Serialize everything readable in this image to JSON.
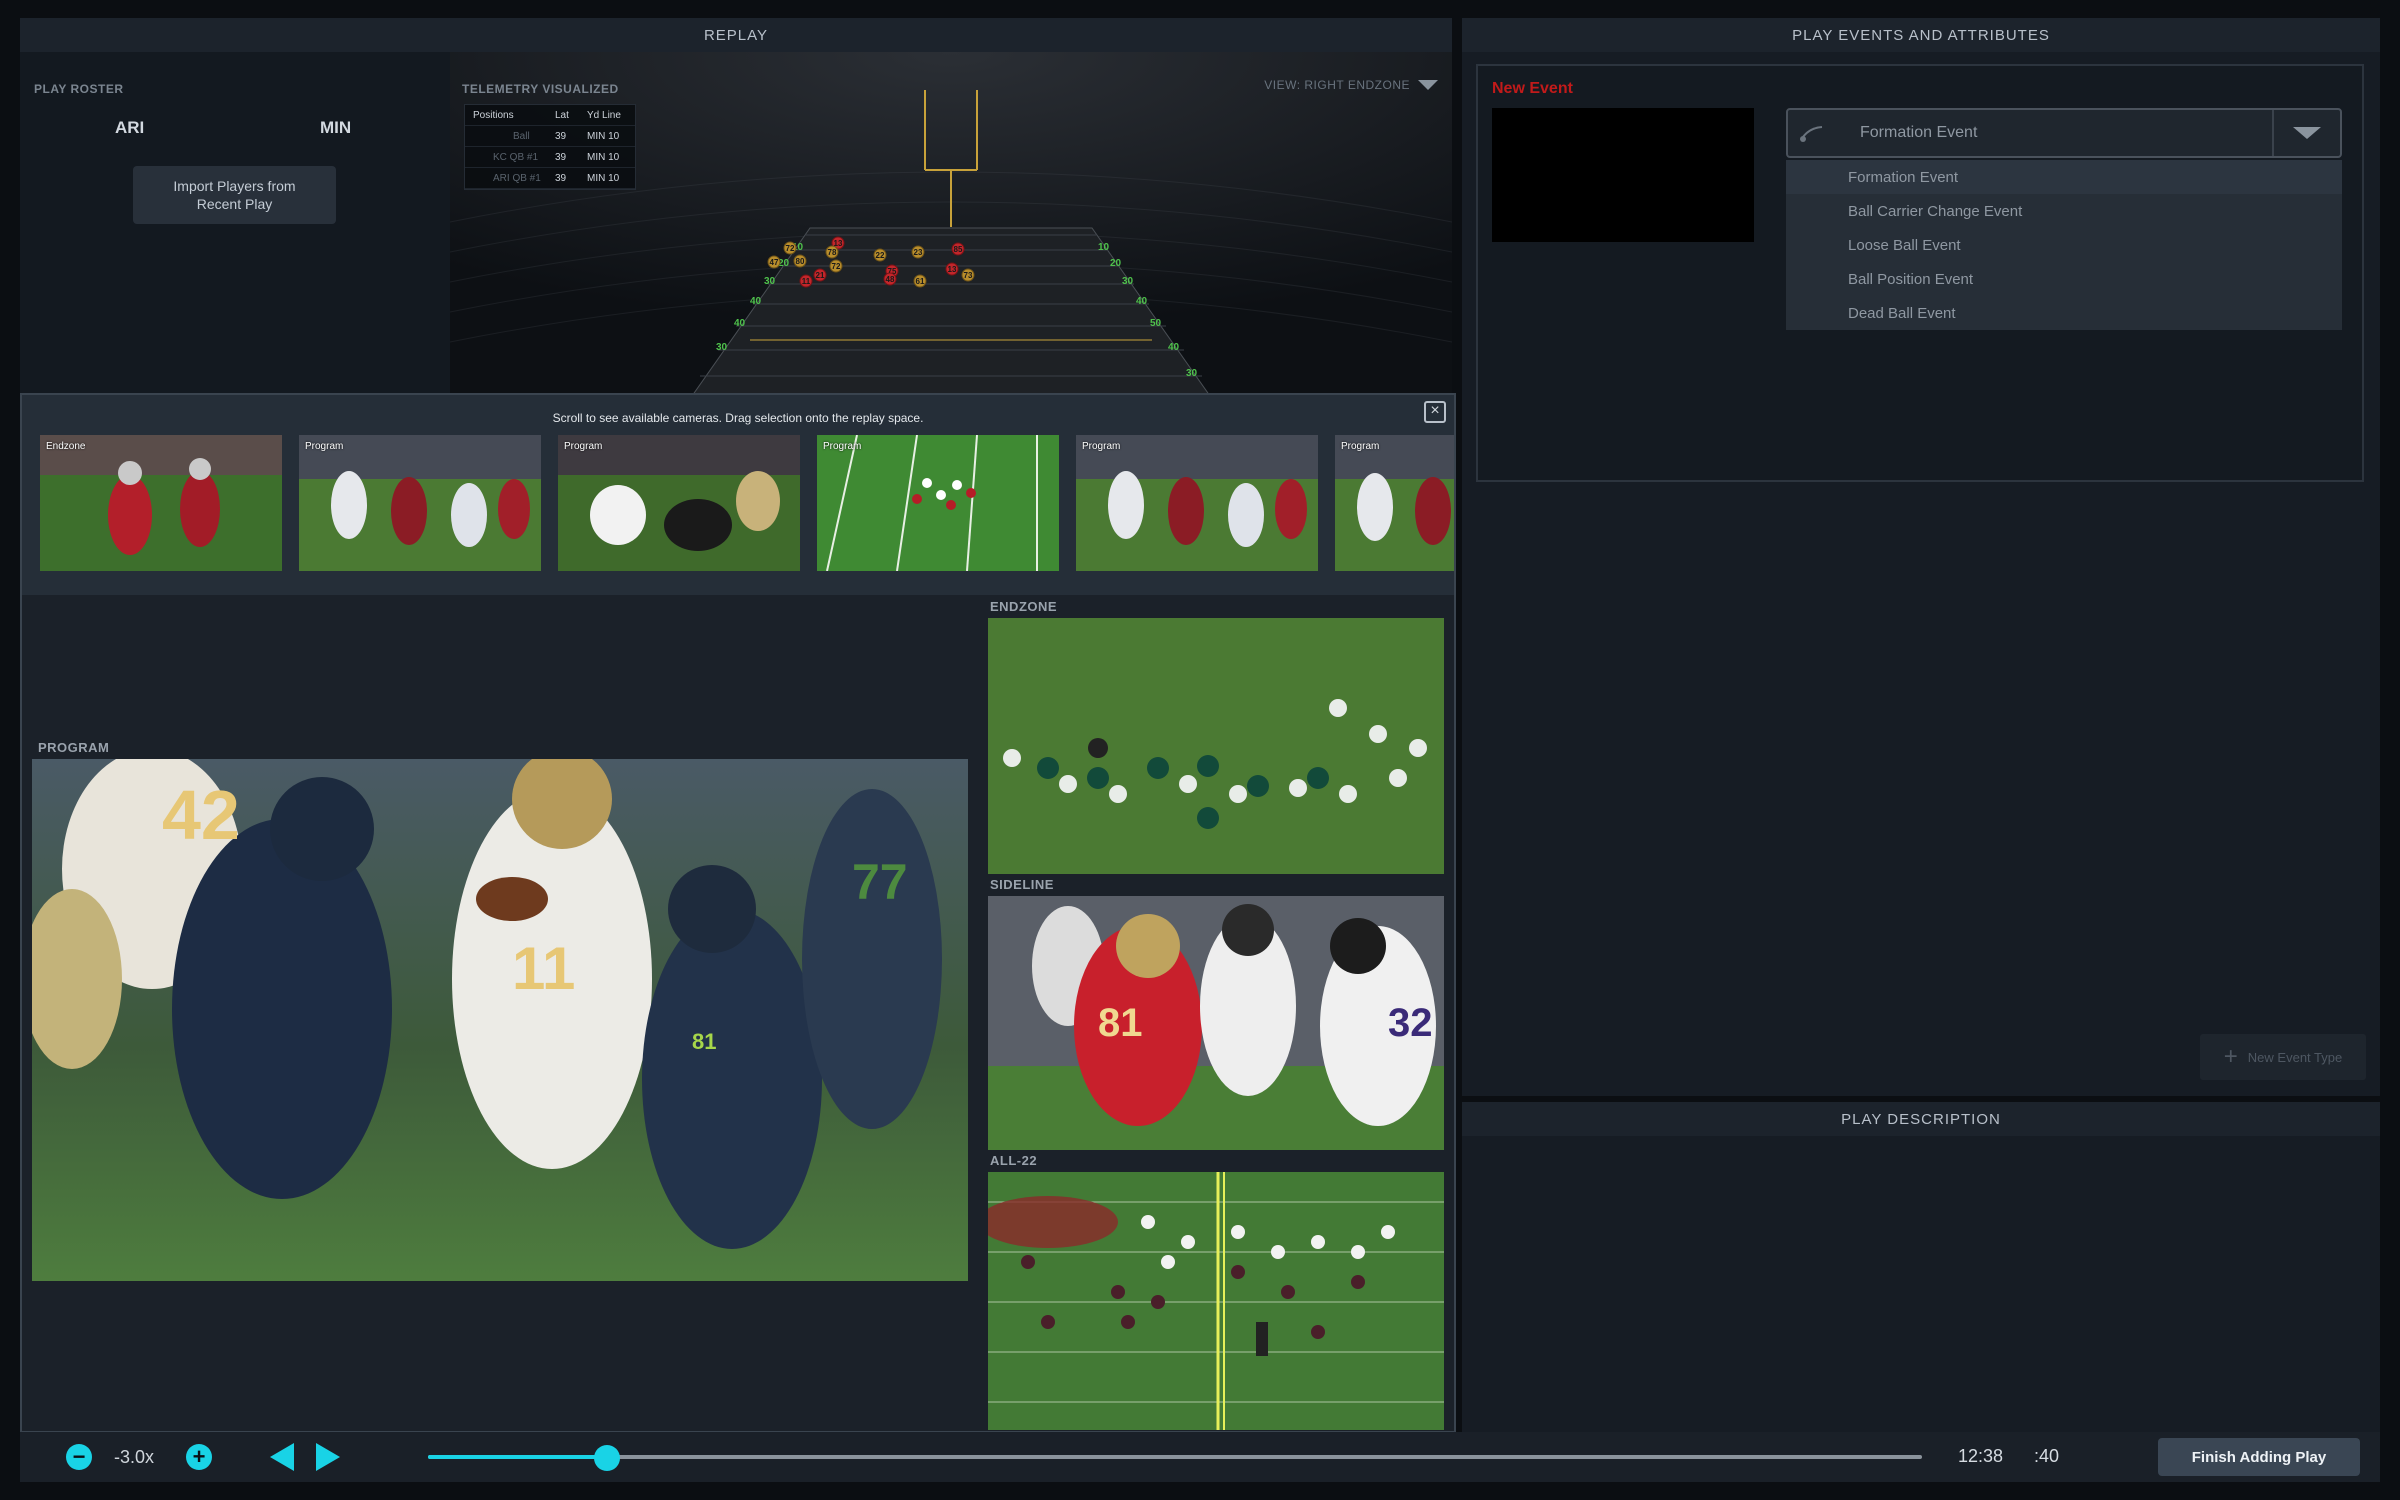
{
  "replay": {
    "title": "REPLAY",
    "roster_label": "PLAY ROSTER",
    "team_left": "ARI",
    "team_right": "MIN",
    "import_button": "Import Players from\nRecent Play",
    "telemetry_label": "TELEMETRY VISUALIZED",
    "view_label": "VIEW: RIGHT ENDZONE",
    "positions": {
      "headers": [
        "Positions",
        "Lat",
        "Yd Line"
      ],
      "rows": [
        {
          "name": "Ball",
          "lat": "39",
          "yd": "MIN 10"
        },
        {
          "name": "KC QB #1",
          "lat": "39",
          "yd": "MIN 10"
        },
        {
          "name": "ARI QB #1",
          "lat": "39",
          "yd": "MIN 10"
        }
      ]
    },
    "yard_markers_left": [
      "10",
      "20",
      "30",
      "40",
      "40",
      "30"
    ],
    "yard_markers_right": [
      "10",
      "20",
      "30",
      "40",
      "50",
      "40",
      "30"
    ],
    "player_numbers_red": [
      "13",
      "85",
      "13",
      "75",
      "21",
      "48",
      "11"
    ],
    "player_numbers_gold": [
      "72",
      "78",
      "22",
      "23",
      "47",
      "80",
      "72",
      "73",
      "61"
    ]
  },
  "events": {
    "title": "PLAY EVENTS AND ATTRIBUTES",
    "new_event_label": "New Event",
    "selected": "Formation Event",
    "options": [
      "Formation Event",
      "Ball Carrier Change Event",
      "Loose Ball Event",
      "Ball Position Event",
      "Dead Ball Event"
    ],
    "new_type_button": "New Event Type"
  },
  "description": {
    "title": "PLAY DESCRIPTION"
  },
  "cameras": {
    "hint": "Scroll to see available cameras. Drag selection onto the replay space.",
    "close": "×",
    "thumbs": [
      "Endzone",
      "Program",
      "Program",
      "Program",
      "Program",
      "Program"
    ],
    "program_label": "PROGRAM",
    "endzone_label": "ENDZONE",
    "sideline_label": "SIDELINE",
    "all22_label": "ALL-22",
    "program_jersey_numbers": [
      "42",
      "11",
      "81",
      "77"
    ],
    "sideline_jersey_numbers": [
      "81",
      "32"
    ]
  },
  "transport": {
    "minus": "−",
    "plus": "+",
    "speed": "-3.0x",
    "progress": 0.12,
    "clock": "12:38",
    "shot_clock": ":40",
    "finish_button": "Finish Adding Play"
  },
  "colors": {
    "accent": "#19d3e6",
    "new_event": "#c21a1a",
    "panel": "#161c24",
    "background": "#0b0e12"
  },
  "icons": [
    "close-icon",
    "chevron-down-icon",
    "event-type-icon",
    "plus-icon",
    "minus-icon",
    "previous-icon",
    "next-icon"
  ]
}
